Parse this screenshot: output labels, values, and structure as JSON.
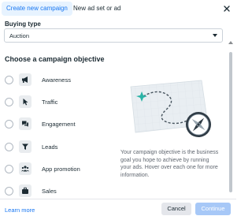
{
  "tabs": {
    "active_label": "Create new campaign",
    "other_label": "New ad set or ad"
  },
  "buying_type": {
    "label": "Buying type",
    "value": "Auction"
  },
  "objective": {
    "title": "Choose a campaign objective",
    "options": [
      {
        "label": "Awareness",
        "icon": "megaphone-icon"
      },
      {
        "label": "Traffic",
        "icon": "cursor-icon"
      },
      {
        "label": "Engagement",
        "icon": "chat-bubbles-icon"
      },
      {
        "label": "Leads",
        "icon": "funnel-icon"
      },
      {
        "label": "App promotion",
        "icon": "people-icon"
      },
      {
        "label": "Sales",
        "icon": "briefcase-icon"
      }
    ],
    "description": "Your campaign objective is the business goal you hope to achieve by running your ads. Hover over each one for more information."
  },
  "footer": {
    "learn_more": "Learn more",
    "cancel": "Cancel",
    "continue": "Continue"
  },
  "colors": {
    "accent": "#1877f2",
    "accent_light": "#e7f3ff",
    "continue_disabled": "#a7c8f7",
    "text": "#1c2b33",
    "muted": "#606770"
  }
}
